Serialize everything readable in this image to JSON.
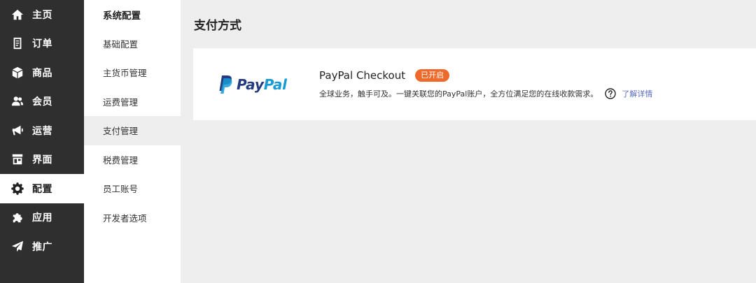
{
  "nav": {
    "items": [
      {
        "label": "主页",
        "icon": "home-icon"
      },
      {
        "label": "订单",
        "icon": "order-document-icon"
      },
      {
        "label": "商品",
        "icon": "product-box-icon"
      },
      {
        "label": "会员",
        "icon": "members-icon"
      },
      {
        "label": "运营",
        "icon": "megaphone-icon"
      },
      {
        "label": "界面",
        "icon": "storefront-icon"
      },
      {
        "label": "配置",
        "icon": "gear-icon"
      },
      {
        "label": "应用",
        "icon": "puzzle-icon"
      },
      {
        "label": "推广",
        "icon": "paper-plane-icon"
      }
    ],
    "active": "配置"
  },
  "subnav": {
    "title": "系统配置",
    "items": [
      {
        "label": "基础配置"
      },
      {
        "label": "主货币管理"
      },
      {
        "label": "运费管理"
      },
      {
        "label": "支付管理"
      },
      {
        "label": "税费管理"
      },
      {
        "label": "员工账号"
      },
      {
        "label": "开发者选项"
      }
    ],
    "active": "支付管理"
  },
  "main": {
    "title": "支付方式",
    "gateway": {
      "logo_pay": "Pay",
      "logo_pal": "Pal",
      "name": "PayPal Checkout",
      "status": "已开启",
      "description": "全球业务，触手可及。一键关联您的PayPal账户，全方位满足您的在线收款需求。",
      "more_link": "了解详情"
    }
  },
  "colors": {
    "nav_bg": "#2f2f2f",
    "badge": "#ee6a2b",
    "paypal_dark": "#253b80",
    "paypal_light": "#179bd7",
    "link": "#5a6bbf"
  }
}
